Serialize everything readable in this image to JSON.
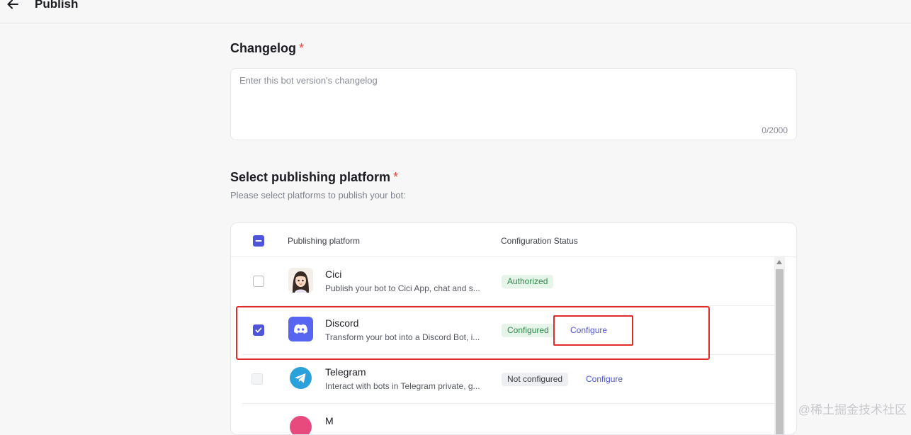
{
  "header": {
    "title": "Publish",
    "back_icon": "arrow-left-icon"
  },
  "changelog": {
    "title": "Changelog",
    "required_mark": "*",
    "placeholder": "Enter this bot version's changelog",
    "value": "",
    "char_count": "0/2000"
  },
  "platform_section": {
    "title": "Select publishing platform",
    "required_mark": "*",
    "subtitle": "Please select platforms to publish your bot:"
  },
  "table": {
    "headers": {
      "platform": "Publishing platform",
      "status": "Configuration Status"
    },
    "select_all_state": "indeterminate",
    "rows": [
      {
        "name": "Cici",
        "description": "Publish your bot to Cici App, chat and s...",
        "status": "Authorized",
        "status_color": "green",
        "checked": false,
        "disabled": false,
        "configure_label": "",
        "icon": "cici-avatar-icon"
      },
      {
        "name": "Discord",
        "description": "Transform your bot into a Discord Bot, i...",
        "status": "Configured",
        "status_color": "green",
        "checked": true,
        "disabled": false,
        "configure_label": "Configure",
        "icon": "discord-icon"
      },
      {
        "name": "Telegram",
        "description": "Interact with bots in Telegram private, g...",
        "status": "Not configured",
        "status_color": "grey",
        "checked": false,
        "disabled": true,
        "configure_label": "Configure",
        "icon": "telegram-icon"
      },
      {
        "name": "M",
        "description": "",
        "status": "",
        "status_color": "",
        "checked": false,
        "disabled": true,
        "configure_label": "",
        "icon": "messenger-icon"
      }
    ]
  },
  "colors": {
    "accent": "#4e55d8",
    "required": "#f04438",
    "highlight": "#e22b2b",
    "authorized_bg": "#e6f4ea",
    "authorized_text": "#2d8a48"
  },
  "watermark": "@稀土掘金技术社区"
}
